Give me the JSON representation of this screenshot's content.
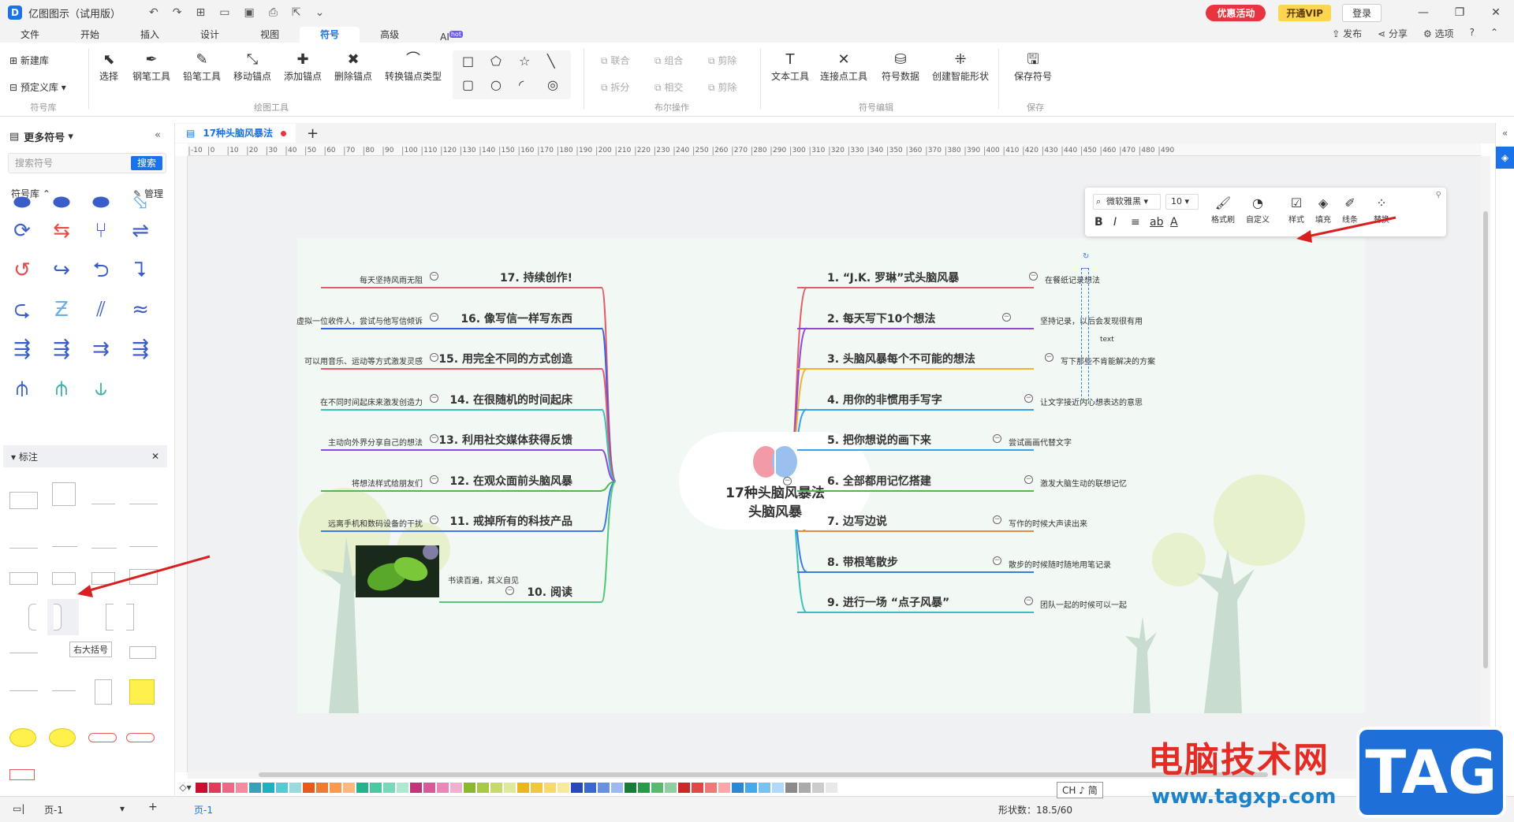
{
  "titlebar": {
    "logo": "D",
    "title": "亿图图示（试用版）",
    "promo": "优惠活动",
    "vip": "开通VIP",
    "login": "登录"
  },
  "menu": {
    "items": [
      "文件",
      "开始",
      "插入",
      "设计",
      "视图",
      "符号",
      "高级",
      "AI"
    ],
    "hot": "hot",
    "right": [
      "发布",
      "分享",
      "选项"
    ]
  },
  "ribbon": {
    "lib_new": "新建库",
    "lib_preset": "预定义库",
    "g_lib": "符号库",
    "draw": [
      "选择",
      "钢笔工具",
      "铅笔工具",
      "移动锚点",
      "添加锚点",
      "删除锚点",
      "转换锚点类型"
    ],
    "g_draw": "绘图工具",
    "bool": [
      "联合",
      "组合",
      "剪除",
      "拆分",
      "相交",
      "剪除"
    ],
    "g_bool": "布尔操作",
    "edit": [
      "文本工具",
      "连接点工具",
      "符号数据",
      "创建智能形状"
    ],
    "g_edit": "符号编辑",
    "save": "保存符号",
    "g_save": "保存"
  },
  "left_panel": {
    "title": "更多符号",
    "search_placeholder": "搜索符号",
    "search_btn": "搜索",
    "lib_label": "符号库",
    "manage": "管理",
    "section": "标注",
    "tooltip": "右大括号"
  },
  "tab": {
    "name": "17种头脑风暴法"
  },
  "ruler": [
    "-10",
    "0",
    "10",
    "20",
    "30",
    "40",
    "50",
    "60",
    "70",
    "80",
    "90",
    "100",
    "110",
    "120",
    "130",
    "140",
    "150",
    "160",
    "170",
    "180",
    "190",
    "200",
    "210",
    "220",
    "230",
    "240",
    "250",
    "260",
    "270",
    "280",
    "290",
    "300",
    "310",
    "320",
    "330",
    "340",
    "350",
    "360",
    "370",
    "380",
    "390",
    "400",
    "410",
    "420",
    "430",
    "440",
    "450",
    "460",
    "470",
    "480",
    "490"
  ],
  "float_toolbar": {
    "font": "微软雅黑",
    "size": "10",
    "buttons": [
      "格式刷",
      "自定义",
      "样式",
      "填充",
      "线条",
      "替换"
    ]
  },
  "mindmap": {
    "center": [
      "17种头脑风暴法",
      "头脑风暴"
    ],
    "right": [
      {
        "title": "1. “J.K. 罗琳”式头脑风暴",
        "note": "在餐纸记录想法",
        "color": "#e85a6a"
      },
      {
        "title": "2. 每天写下10个想法",
        "note": "坚持记录，以后会发现很有用",
        "color": "#8b4bd8"
      },
      {
        "title": "3. 头脑风暴每个不可能的想法",
        "note": "写下那些不肯能解决的方案",
        "color": "#f2b230"
      },
      {
        "title": "4. 用你的非惯用手写字",
        "note": "让文字接近内心想表达的意思",
        "color": "#3aa0e8"
      },
      {
        "title": "5. 把你想说的画下来",
        "note": "尝试画画代替文字",
        "color": "#3aa0e8"
      },
      {
        "title": "6. 全部都用记忆搭建",
        "note": "激发大脑生动的联想记忆",
        "color": "#52b84a"
      },
      {
        "title": "7. 边写边说",
        "note": "写作的时候大声读出来",
        "color": "#e88a3a"
      },
      {
        "title": "8. 带根笔散步",
        "note": "散步的时候随时随地用笔记录",
        "color": "#3a7be8"
      },
      {
        "title": "9. 进行一场 “点子风暴”",
        "note": "团队一起的时候可以一起",
        "color": "#3ac0b8"
      }
    ],
    "left": [
      {
        "title": "17. 持续创作!",
        "note": "每天坚持风雨无阻",
        "color": "#e85a6a"
      },
      {
        "title": "16. 像写信一样写东西",
        "note": "虚拟一位收件人，尝试与他写信倾诉",
        "color": "#3a5ee8"
      },
      {
        "title": "15. 用完全不同的方式创造",
        "note": "可以用音乐、运动等方式激发灵感",
        "color": "#e85a6a"
      },
      {
        "title": "14. 在很随机的时间起床",
        "note": "在不同时间起床来激发创造力",
        "color": "#3ac0b8"
      },
      {
        "title": "13. 利用社交媒体获得反馈",
        "note": "主动向外界分享自己的想法",
        "color": "#8b4bd8"
      },
      {
        "title": "12. 在观众面前头脑风暴",
        "note": "将想法样式给朋友们",
        "color": "#52b84a"
      },
      {
        "title": "11. 戒掉所有的科技产品",
        "note": "远离手机和数码设备的干扰",
        "color": "#3a7be8"
      },
      {
        "title": "10. 阅读",
        "note": "书读百遍，其义自见",
        "color": "#52c87a"
      }
    ],
    "selection_label": "text"
  },
  "status": {
    "page_tab": "页-1",
    "page_tab2": "页-1",
    "shape_count": "形状数：18.5/60",
    "ime": "CH ♪ 简"
  },
  "watermark": {
    "cn": "电脑技术网",
    "url": "www.tagxp.com",
    "tag": "TAG"
  },
  "palette": [
    "#c8102e",
    "#e03c5a",
    "#e86a85",
    "#f28ca0",
    "#3aa0b8",
    "#1fb0c0",
    "#5ac8d0",
    "#9adbe0",
    "#e85a1a",
    "#f07a30",
    "#f89a50",
    "#fbb880",
    "#28b28c",
    "#4ac8a0",
    "#7ad8b8",
    "#b0e8d0",
    "#c0367a",
    "#d85a98",
    "#e888b8",
    "#f0b0d0",
    "#8ab82a",
    "#a8c84a",
    "#c8d870",
    "#e0e8a0",
    "#e8b81a",
    "#f0c840",
    "#f8d870",
    "#f8e8a0",
    "#2a48b8",
    "#3a68d0",
    "#6a90e0",
    "#a0b8f0",
    "#1a7a3a",
    "#2a9a4a",
    "#5ab870",
    "#90d0a0",
    "#c82a2a",
    "#e04848",
    "#f07878",
    "#f8a8a8",
    "#2a88d8",
    "#4aa8e8",
    "#7ac0f0",
    "#b0d8f8",
    "#8a8a8a",
    "#aaaaaa",
    "#cccccc",
    "#e8e8e8"
  ]
}
